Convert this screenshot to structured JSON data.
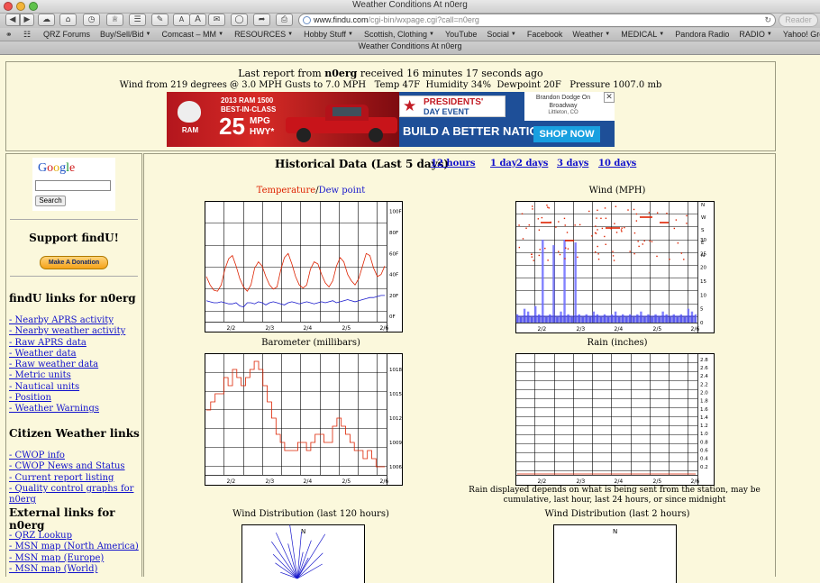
{
  "window": {
    "title": "Weather Conditions At n0erg"
  },
  "toolbar": {
    "url_host": "www.findu.com",
    "url_path": "/cgi-bin/wxpage.cgi?call=n0erg",
    "reader_label": "Reader"
  },
  "bookmarks": [
    {
      "label": "QRZ Forums",
      "menu": false
    },
    {
      "label": "Buy/Sell/Bid",
      "menu": true
    },
    {
      "label": "Comcast – MM",
      "menu": true
    },
    {
      "label": "RESOURCES",
      "menu": true
    },
    {
      "label": "Hobby Stuff",
      "menu": true
    },
    {
      "label": "Scottish, Clothing",
      "menu": true
    },
    {
      "label": "YouTube",
      "menu": false
    },
    {
      "label": "Social",
      "menu": true
    },
    {
      "label": "Facebook",
      "menu": false
    },
    {
      "label": "Weather",
      "menu": true
    },
    {
      "label": "MEDICAL",
      "menu": true
    },
    {
      "label": "Pandora Radio",
      "menu": false
    },
    {
      "label": "RADIO",
      "menu": true
    },
    {
      "label": "Yahoo! Groups",
      "menu": false
    }
  ],
  "tab": {
    "title": "Weather Conditions At n0erg"
  },
  "report": {
    "line1_prefix": "Last report from ",
    "callsign": "n0erg",
    "line1_suffix": " received 16 minutes 17 seconds ago",
    "line2": "Wind from 219 degrees @ 3.0 MPH Gusts to 7.0 MPH   Temp 47F  Humidity 34%  Dewpoint 20F   Pressure 1007.0 mb"
  },
  "ad": {
    "model": "2013 RAM 1500",
    "tag1": "BEST-IN-CLASS",
    "mpg_num": "25",
    "mpg_unit": "MPG",
    "hwy": "HWY*",
    "brand": "RAM",
    "event_line1": "PRESIDENTS'",
    "event_line2": "DAY EVENT",
    "slogan": "BUILD A BETTER NATION.",
    "cta": "SHOP NOW",
    "dealer_line1": "Brandon Dodge On",
    "dealer_line2": "Broadway",
    "dealer_line3": "Littleton, CO",
    "close": "✕"
  },
  "sidebar": {
    "search_button": "Search",
    "support_title": "Support findU!",
    "donate_label": "Make A Donation",
    "findu_title": "findU links for n0erg",
    "findu_links": [
      "- Nearby APRS activity",
      "- Nearby weather activity",
      "- Raw APRS data",
      "- Weather data",
      "- Raw weather data",
      "- Metric units",
      "- Nautical units",
      "- Position",
      "- Weather Warnings"
    ],
    "cw_title": "Citizen Weather links",
    "cw_links": [
      "- CWOP info",
      "- CWOP News and Status",
      "- Current report listing",
      "- Quality control graphs for n0erg"
    ],
    "ext_title": "External links for n0erg",
    "ext_links": [
      "- QRZ Lookup",
      "- MSN map (North America)",
      "- MSN map (Europe)",
      "- MSN map (World)"
    ]
  },
  "historical": {
    "title": "Historical Data (Last 5 days)",
    "links": [
      "12 hours",
      "1 day",
      "2 days",
      "3 days",
      "10 days"
    ]
  },
  "charts": {
    "temp_title_a": "Temperature",
    "temp_title_sep": "/",
    "temp_title_b": "Dew point",
    "wind_title": "Wind (MPH)",
    "baro_title": "Barometer (millibars)",
    "rain_title": "Rain (inches)",
    "rain_note": "Rain displayed depends on what is being sent from the station, may be cumulative, last hour, last 24 hours, or since midnight",
    "winddist_title": "Wind Distribution (last 120 hours)",
    "winddist2_title": "Wind Distribution (last 2 hours)",
    "north_label": "N"
  },
  "colors": {
    "temp": "#dd2200",
    "dew": "#1a1acc",
    "link": "#1111cc",
    "page_bg": "#fbf8dc"
  },
  "chart_data": [
    {
      "type": "line",
      "title": "Temperature/Dew point",
      "x_ticks": [
        "2/2",
        "2/3",
        "2/4",
        "2/5",
        "2/6"
      ],
      "y_ticks": [
        "0F",
        "20F",
        "40F",
        "60F",
        "80F",
        "100F"
      ],
      "ylim": [
        -5,
        110
      ],
      "series": [
        {
          "name": "Temperature",
          "color": "#dd2200",
          "values": [
            38,
            30,
            25,
            24,
            30,
            45,
            55,
            58,
            48,
            36,
            28,
            24,
            30,
            46,
            52,
            48,
            38,
            30,
            26,
            28,
            44,
            56,
            60,
            50,
            38,
            30,
            27,
            30,
            45,
            52,
            50,
            40,
            32,
            28,
            34,
            48,
            56,
            52,
            40,
            34,
            30,
            36,
            48,
            60,
            58,
            46,
            38,
            40,
            48
          ]
        },
        {
          "name": "Dew point",
          "color": "#1a1acc",
          "values": [
            15,
            14,
            13,
            13,
            14,
            13,
            12,
            12,
            13,
            10,
            9,
            13,
            13,
            12,
            14,
            13,
            11,
            13,
            14,
            13,
            12,
            11,
            13,
            14,
            13,
            12,
            13,
            14,
            13,
            12,
            13,
            14,
            13,
            14,
            15,
            13,
            14,
            15,
            16,
            15,
            14,
            15,
            16,
            17,
            18,
            18,
            19,
            20,
            20
          ]
        }
      ]
    },
    {
      "type": "scatter",
      "title": "Wind (MPH)",
      "x_ticks": [
        "2/2",
        "2/3",
        "2/4",
        "2/5",
        "2/6"
      ],
      "y_ticks": [
        "0",
        "5",
        "10",
        "15",
        "20",
        "25",
        "30"
      ],
      "dir_ticks": [
        "N",
        "W",
        "S",
        "E",
        "N"
      ],
      "ylim": [
        0,
        30
      ],
      "speed_series": [
        3,
        2,
        5,
        4,
        2,
        6,
        3,
        30,
        2,
        3,
        28,
        2,
        4,
        30,
        3,
        2,
        29,
        3,
        2,
        3,
        2,
        4,
        3,
        2,
        3,
        2,
        3,
        4,
        2,
        3,
        2,
        3,
        2,
        3,
        4,
        2,
        3,
        2,
        3,
        2,
        4,
        3,
        2,
        3,
        2,
        3,
        2,
        5,
        4,
        3
      ]
    },
    {
      "type": "line",
      "title": "Barometer (millibars)",
      "x_ticks": [
        "2/2",
        "2/3",
        "2/4",
        "2/5",
        "2/6"
      ],
      "y_ticks": [
        "1006",
        "1009",
        "1012",
        "1015",
        "1018"
      ],
      "ylim": [
        1005,
        1020
      ],
      "series": [
        {
          "name": "Barometer",
          "color": "#dd2200",
          "values": [
            1013,
            1014,
            1015,
            1015,
            1017,
            1016,
            1018,
            1017,
            1016,
            1017,
            1018,
            1019,
            1018,
            1016,
            1014,
            1012,
            1010,
            1009,
            1008,
            1008,
            1008,
            1009,
            1009,
            1008,
            1009,
            1010,
            1010,
            1009,
            1009,
            1011,
            1012,
            1011,
            1010,
            1009,
            1008,
            1008,
            1007,
            1008,
            1007,
            1006,
            1006,
            1006
          ]
        }
      ]
    },
    {
      "type": "line",
      "title": "Rain (inches)",
      "x_ticks": [
        "2/2",
        "2/3",
        "2/4",
        "2/5",
        "2/6"
      ],
      "y_ticks": [
        "0.2",
        "0.4",
        "0.6",
        "0.8",
        "1.0",
        "1.2",
        "1.4",
        "1.6",
        "1.8",
        "2.0",
        "2.2",
        "2.4",
        "2.6",
        "2.8"
      ],
      "ylim": [
        0,
        2.95
      ],
      "series": [
        {
          "name": "Rain",
          "color": "#dd2200",
          "values": [
            0,
            0,
            0,
            0,
            0,
            0,
            0,
            0,
            0,
            0,
            0,
            0
          ]
        }
      ]
    }
  ]
}
